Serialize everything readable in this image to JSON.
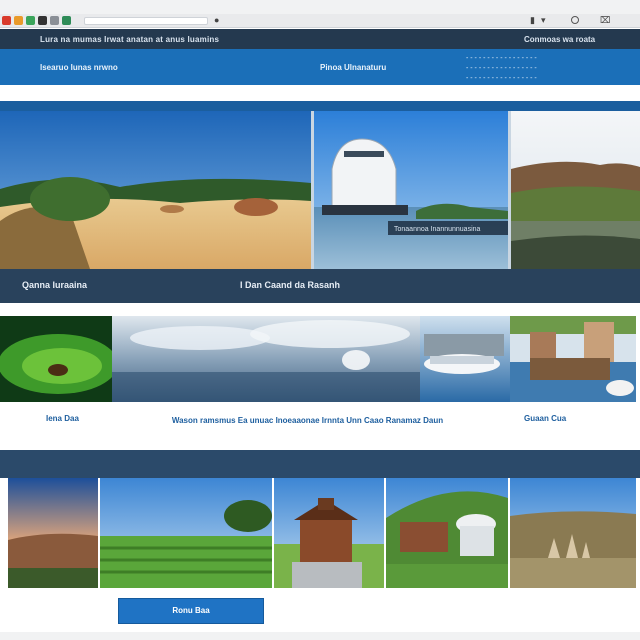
{
  "browser": {
    "icons": [
      "tab-icon-red",
      "tab-icon-orange",
      "tab-icon-green",
      "tab-icon-dark",
      "tab-icon-gray",
      "tab-icon-green"
    ]
  },
  "header": {
    "top_links": "Lura na mumas Irwat anatan at anus luamins",
    "top_right": "Conmoas wa roata",
    "nav_left": "Isearuo Iunas nrwno",
    "nav_mid": "Pinoa Ulnanaturu",
    "nav_right_1": "- - - - - - - - - - - - - - - - -",
    "nav_right_2": "- - - - - - - - - - - - - - - - -",
    "nav_right_3": "- - - - - - - - - - - - - - - - -"
  },
  "gallery_top": {
    "caption_left": "Qanna Iuraaina",
    "caption_right": "I Dan Caand da Rasanh",
    "overlay_text": "Tonaannoa Inannunnuasina"
  },
  "gallery_mid": {
    "label_left": "Iena Daa",
    "label_center": "Wason ramsmus Ea unuac Inoeaaonae Irnnta Unn Caao Ranamaz Daun",
    "label_right": "Guaan Cua"
  },
  "cta": {
    "label": "Ronu Baa"
  },
  "colors": {
    "accent": "#1b6fb8",
    "dark_navy": "#24394f",
    "caption_band": "#29425c",
    "button": "#1f73c4"
  }
}
